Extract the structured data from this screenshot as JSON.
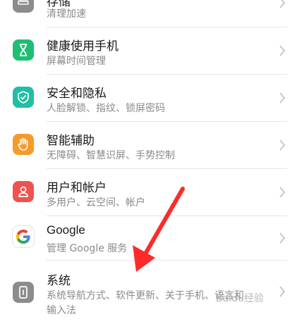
{
  "settings": {
    "items": [
      {
        "title": "存储",
        "subtitle": "清理加速",
        "icon": "storage-icon",
        "color": "#8c8c8c"
      },
      {
        "title": "健康使用手机",
        "subtitle": "屏幕时间管理",
        "icon": "hourglass-icon",
        "color": "#1fbf73"
      },
      {
        "title": "安全和隐私",
        "subtitle": "人脸解锁、指纹、锁屏密码",
        "icon": "shield-icon",
        "color": "#1fbfa5"
      },
      {
        "title": "智能辅助",
        "subtitle": "无障碍、智慧识屏、手势控制",
        "icon": "hand-icon",
        "color": "#f59b2b"
      },
      {
        "title": "用户和帐户",
        "subtitle": "多用户、云空间、帐户",
        "icon": "user-icon",
        "color": "#ef5350"
      },
      {
        "title": "Google",
        "subtitle": "管理 Google 服务",
        "icon": "google-icon",
        "color": "#ffffff"
      },
      {
        "title": "系统",
        "subtitle": "系统导航方式、软件更新、关于手机、语言和",
        "subtitle2": "输入法",
        "icon": "system-icon",
        "color": "#8c8c8c"
      }
    ]
  },
  "watermark": {
    "text": "Baidu经验"
  },
  "annotation": {
    "arrow_color": "#ff2a2a"
  }
}
